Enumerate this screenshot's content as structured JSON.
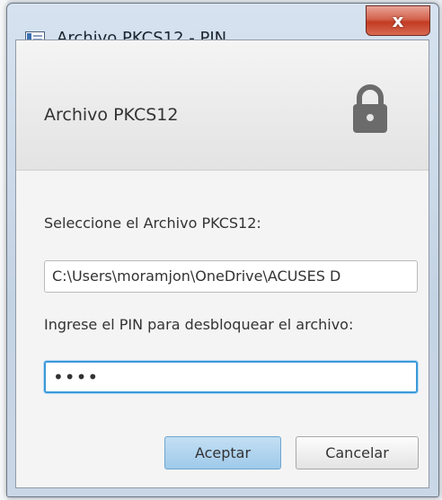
{
  "window": {
    "title": "Archivo PKCS12 - PIN",
    "close_label": "x"
  },
  "header": {
    "title": "Archivo PKCS12",
    "icon": "lock-icon"
  },
  "form": {
    "file_label": "Seleccione el Archivo PKCS12:",
    "file_value": "C:\\Users\\moramjon\\OneDrive\\ACUSES D",
    "pin_label": "Ingrese el PIN para desbloquear el archivo:",
    "pin_value": "••••"
  },
  "buttons": {
    "accept_label": "Aceptar",
    "cancel_label": "Cancelar"
  },
  "colors": {
    "focus_border": "#3c9ad9",
    "default_button": "#9fcaea",
    "close_button": "#c23b22"
  }
}
